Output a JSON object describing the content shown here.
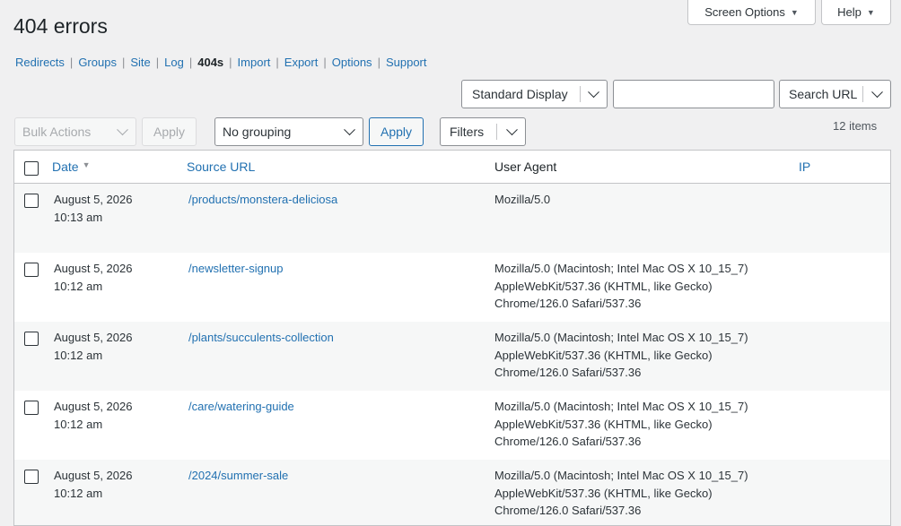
{
  "header": {
    "screen_options": "Screen Options",
    "help": "Help",
    "title": "404 errors"
  },
  "nav": [
    "Redirects",
    "Groups",
    "Site",
    "Log",
    "404s",
    "Import",
    "Export",
    "Options",
    "Support"
  ],
  "nav_current": "404s",
  "toolbar": {
    "display": "Standard Display",
    "search_value": "",
    "search_button": "Search URL",
    "bulk_actions": "Bulk Actions",
    "bulk_apply": "Apply",
    "grouping": "No grouping",
    "grouping_apply": "Apply",
    "filters": "Filters",
    "item_count": "12 items"
  },
  "table": {
    "columns": {
      "date": "Date",
      "source_url": "Source URL",
      "user_agent": "User Agent",
      "ip": "IP"
    },
    "rows": [
      {
        "date": "August 5, 2026",
        "time": "10:13 am",
        "url": "/products/monstera-deliciosa",
        "ua": "Mozilla/5.0",
        "ip": ""
      },
      {
        "date": "August 5, 2026",
        "time": "10:12 am",
        "url": "/newsletter-signup",
        "ua": "Mozilla/5.0 (Macintosh; Intel Mac OS X 10_15_7) AppleWebKit/537.36 (KHTML, like Gecko) Chrome/126.0 Safari/537.36",
        "ip": ""
      },
      {
        "date": "August 5, 2026",
        "time": "10:12 am",
        "url": "/plants/succulents-collection",
        "ua": "Mozilla/5.0 (Macintosh; Intel Mac OS X 10_15_7) AppleWebKit/537.36 (KHTML, like Gecko) Chrome/126.0 Safari/537.36",
        "ip": ""
      },
      {
        "date": "August 5, 2026",
        "time": "10:12 am",
        "url": "/care/watering-guide",
        "ua": "Mozilla/5.0 (Macintosh; Intel Mac OS X 10_15_7) AppleWebKit/537.36 (KHTML, like Gecko) Chrome/126.0 Safari/537.36",
        "ip": ""
      },
      {
        "date": "August 5, 2026",
        "time": "10:12 am",
        "url": "/2024/summer-sale",
        "ua": "Mozilla/5.0 (Macintosh; Intel Mac OS X 10_15_7) AppleWebKit/537.36 (KHTML, like Gecko) Chrome/126.0 Safari/537.36",
        "ip": ""
      }
    ]
  },
  "colors": {
    "link": "#2271b1",
    "background": "#f0f0f1",
    "alt_row": "#f6f7f7"
  }
}
